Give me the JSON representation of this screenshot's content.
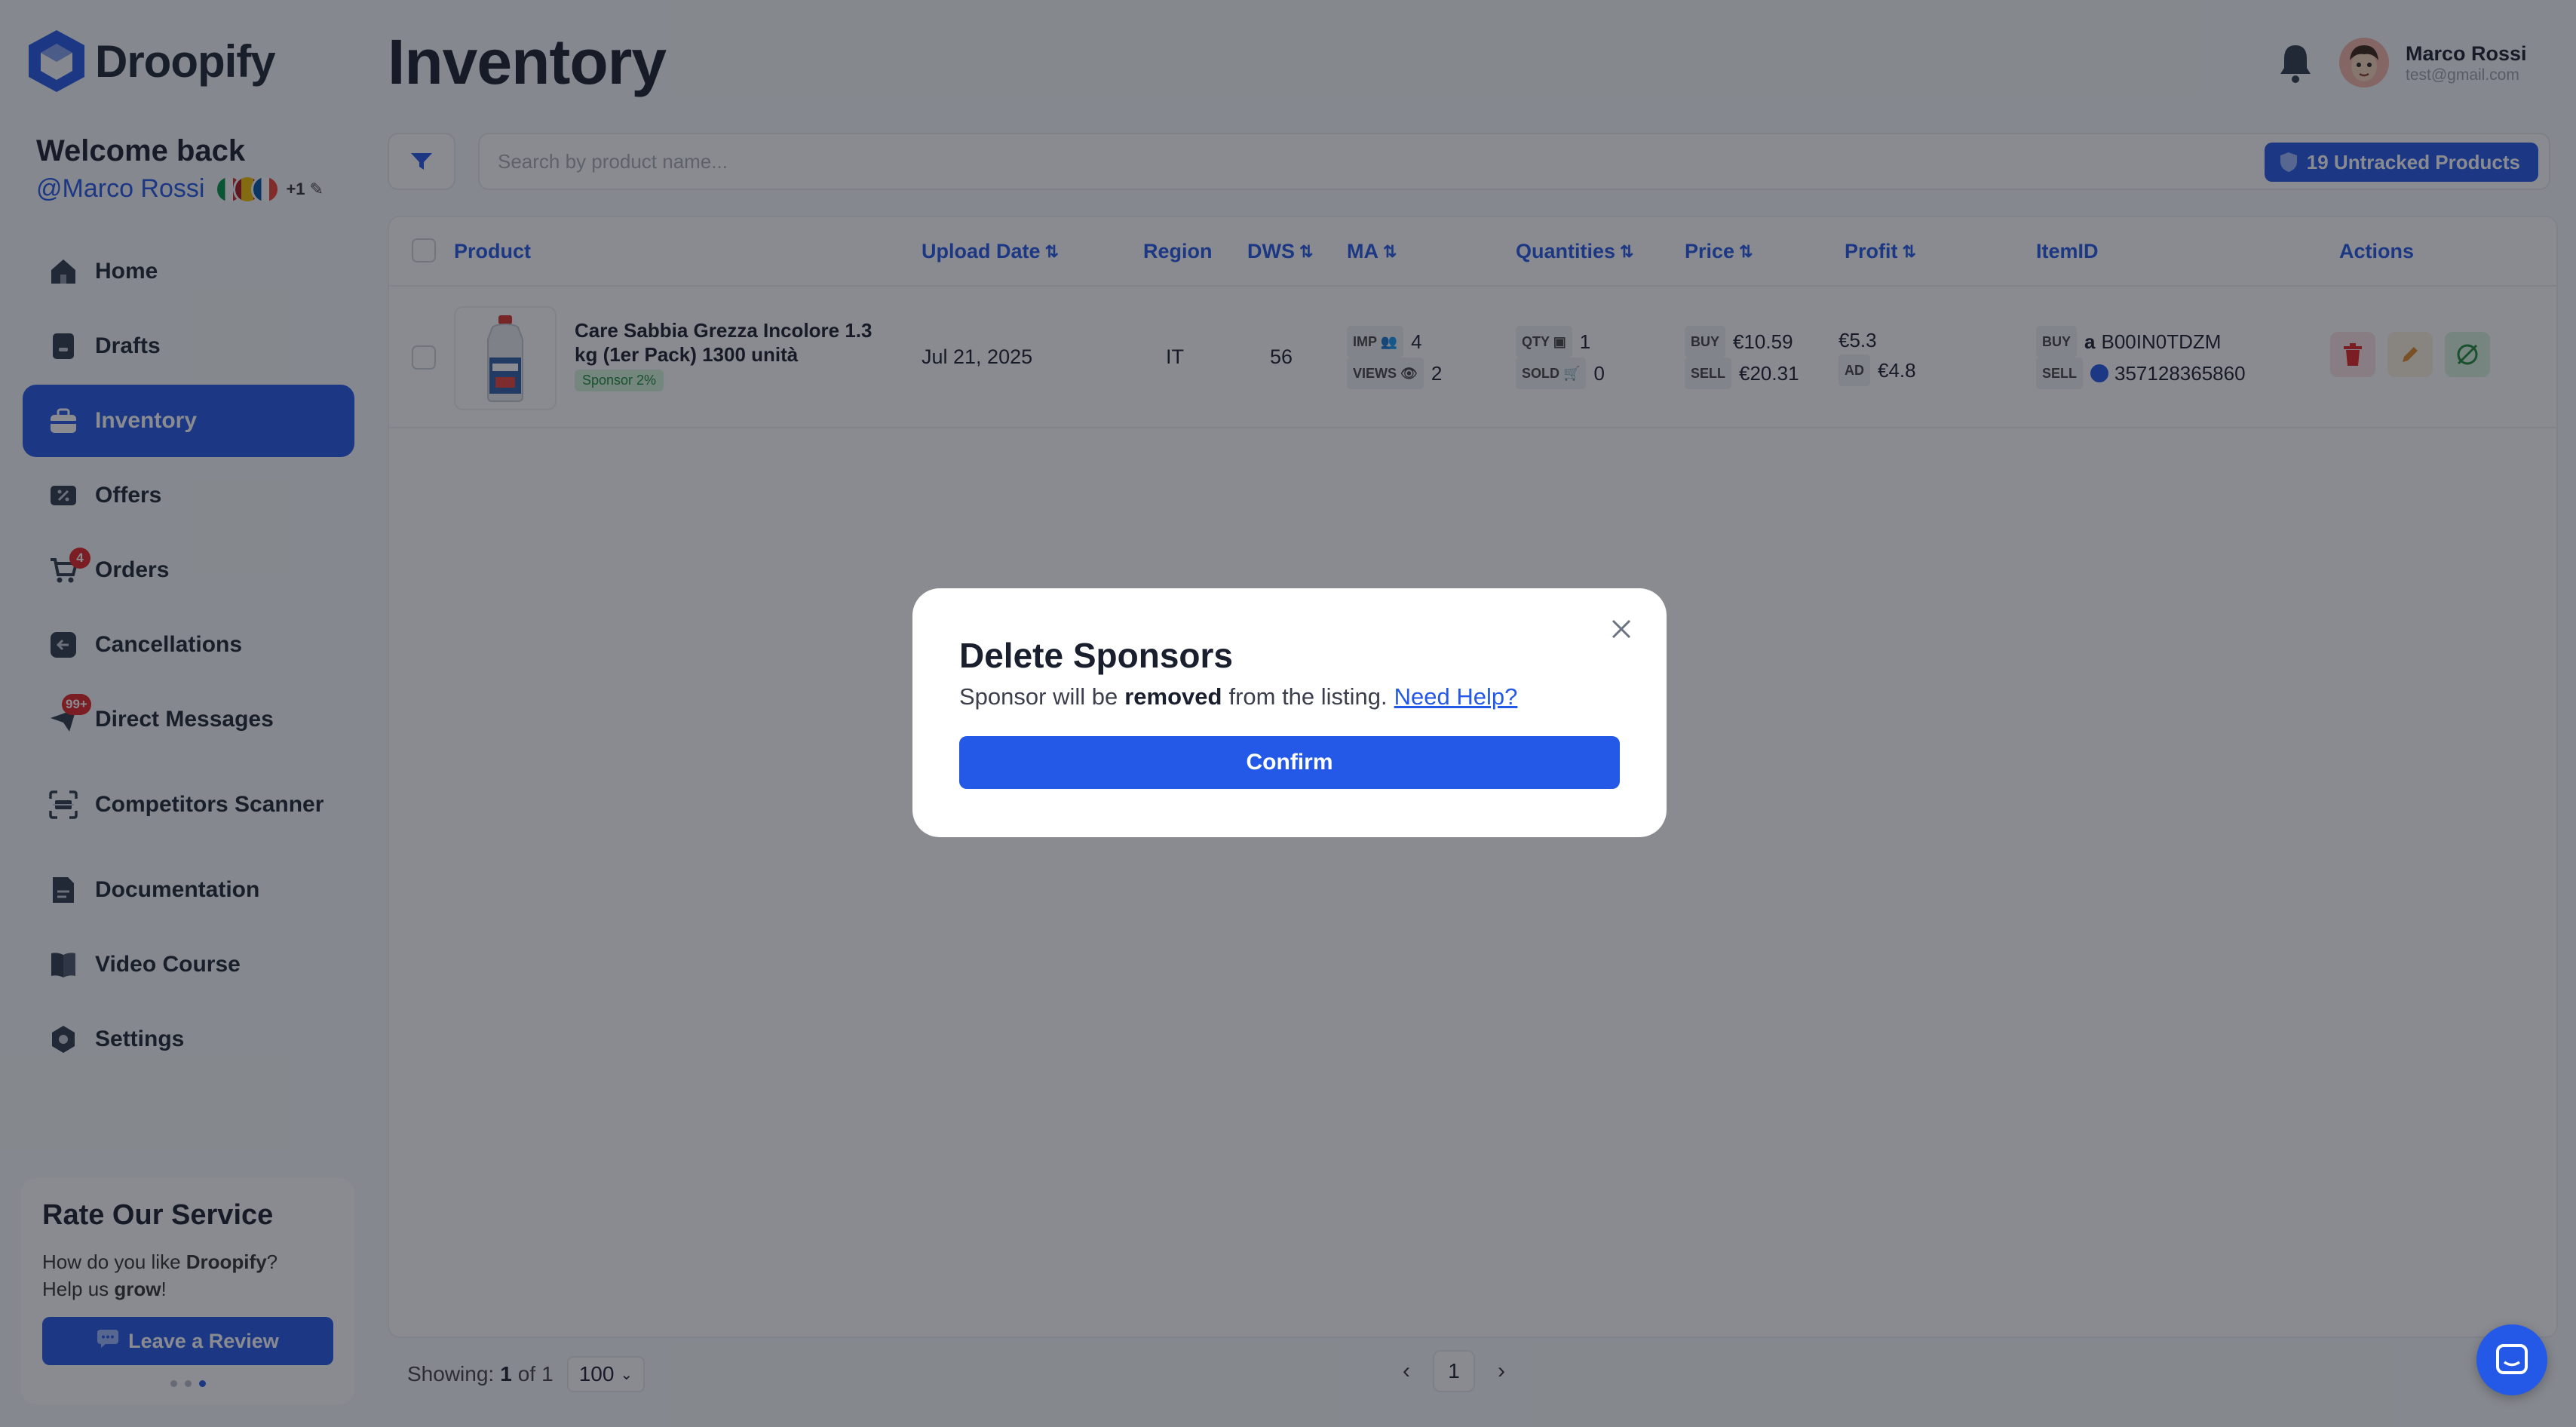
{
  "app": {
    "name": "Droopify"
  },
  "welcome": {
    "title": "Welcome back",
    "username": "@Marco Rossi",
    "flags_more": "+1"
  },
  "sidebar": {
    "items": [
      {
        "label": "Home",
        "icon": "home-icon"
      },
      {
        "label": "Drafts",
        "icon": "drafts-icon"
      },
      {
        "label": "Inventory",
        "icon": "inventory-icon",
        "active": true
      },
      {
        "label": "Offers",
        "icon": "offers-icon"
      },
      {
        "label": "Orders",
        "icon": "cart-icon",
        "badge": "4"
      },
      {
        "label": "Cancellations",
        "icon": "cancellations-icon"
      },
      {
        "label": "Direct Messages",
        "icon": "messages-icon",
        "badge": "99+"
      },
      {
        "label": "Competitors Scanner",
        "icon": "scanner-icon"
      },
      {
        "label": "Documentation",
        "icon": "documentation-icon"
      },
      {
        "label": "Video Course",
        "icon": "video-course-icon"
      },
      {
        "label": "Settings",
        "icon": "settings-icon"
      }
    ]
  },
  "rate_card": {
    "title": "Rate Our Service",
    "line1_prefix": "How do you like ",
    "line1_brand": "Droopify",
    "line1_suffix": "?",
    "line2_prefix": "Help us ",
    "line2_bold": "grow",
    "line2_suffix": "!",
    "button_label": "Leave a Review"
  },
  "header": {
    "title": "Inventory",
    "user_name": "Marco Rossi",
    "user_email": "test@gmail.com"
  },
  "search": {
    "placeholder": "Search by product name...",
    "untracked_label": "19 Untracked Products"
  },
  "table": {
    "columns": [
      "Product",
      "Upload Date",
      "Region",
      "DWS",
      "MA",
      "Quantities",
      "Price",
      "Profit",
      "ItemID",
      "Actions"
    ],
    "rows": [
      {
        "product_name": "Care Sabbia Grezza Incolore 1.3 kg (1er Pack) 1300 unità",
        "sponsor_tag": "Sponsor 2%",
        "upload_date": "Jul 21, 2025",
        "region": "IT",
        "dws": "56",
        "ma_imp_label": "IMP",
        "ma_imp": "4",
        "ma_views_label": "VIEWS",
        "ma_views": "2",
        "qty_label": "QTY",
        "qty": "1",
        "sold_label": "SOLD",
        "sold": "0",
        "buy_label": "BUY",
        "buy_price": "€10.59",
        "sell_label": "SELL",
        "sell_price": "€20.31",
        "profit": "€5.3",
        "ad_label": "AD",
        "ad": "€4.8",
        "id_buy_label": "BUY",
        "id_buy": "B00IN0TDZM",
        "id_sell_label": "SELL",
        "id_sell": "357128365860"
      }
    ]
  },
  "pagination": {
    "showing_label": "Showing:",
    "current": "1",
    "of_label": "of",
    "total": "1",
    "per_page": "100",
    "page": "1"
  },
  "modal": {
    "title": "Delete Sponsors",
    "text_prefix": "Sponsor will be",
    "text_bold": "removed",
    "text_suffix": "from the listing.",
    "help_link": "Need Help?",
    "confirm_label": "Confirm"
  },
  "colors": {
    "accent": "#2458e6",
    "danger": "#e02424",
    "overlay": "rgba(20,24,33,0.5)"
  }
}
